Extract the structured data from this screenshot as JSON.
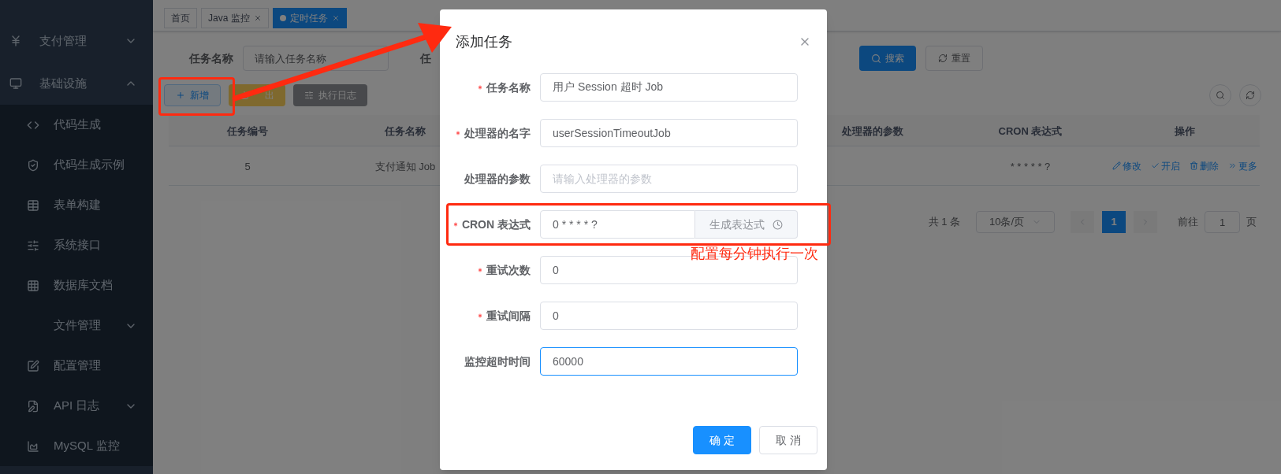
{
  "sidebar": {
    "items": [
      {
        "label": "支付管理",
        "expanded": false
      },
      {
        "label": "基础设施",
        "expanded": true,
        "children": [
          {
            "label": "代码生成"
          },
          {
            "label": "代码生成示例"
          },
          {
            "label": "表单构建"
          },
          {
            "label": "系统接口"
          },
          {
            "label": "数据库文档"
          },
          {
            "label": "文件管理",
            "expanded": false
          },
          {
            "label": "配置管理"
          },
          {
            "label": "API 日志",
            "expanded": false
          },
          {
            "label": "MySQL 监控"
          }
        ]
      }
    ]
  },
  "tabs": [
    {
      "label": "首页",
      "selected": false,
      "closable": false
    },
    {
      "label": "Java 监控",
      "selected": false,
      "closable": true
    },
    {
      "label": "定时任务",
      "selected": true,
      "closable": true
    }
  ],
  "search": {
    "fields": [
      {
        "label": "任务名称",
        "placeholder": "请输入任务名称"
      },
      {
        "label": "任"
      }
    ],
    "buttons": [
      "搜索",
      "重置"
    ]
  },
  "toolbar": {
    "buttons": [
      {
        "kind": "add",
        "label": "新增"
      },
      {
        "kind": "export",
        "label": "出"
      },
      {
        "kind": "log",
        "label": "执行日志"
      }
    ]
  },
  "table": {
    "columns": [
      "任务编号",
      "任务名称",
      "处理器的参数",
      "CRON 表达式",
      "操作"
    ],
    "rows": [
      {
        "cells": [
          "5",
          "支付通知 Job",
          "",
          "* * * * * ?"
        ],
        "actions": [
          "修改",
          "开启",
          "删除",
          "更多"
        ]
      }
    ]
  },
  "pagination": {
    "total": "共 1 条",
    "page_size": "10条/页",
    "pages": [
      {
        "label": "1",
        "selected": true
      }
    ],
    "goto_label": "前往",
    "goto_value": "1",
    "goto_suffix": "页"
  },
  "dialog": {
    "title": "添加任务",
    "fields": [
      {
        "label": "任务名称",
        "required": true,
        "value": "用户 Session 超时 Job",
        "focused": false
      },
      {
        "label": "处理器的名字",
        "required": true,
        "value": "userSessionTimeoutJob",
        "focused": false
      },
      {
        "label": "处理器的参数",
        "required": false,
        "placeholder": "请输入处理器的参数",
        "focused": false
      },
      {
        "label": "CRON 表达式",
        "required": true,
        "value": "0 * * * * ?",
        "focused": false,
        "addon": "生成表达式"
      },
      {
        "label": "重试次数",
        "required": true,
        "value": "0",
        "focused": false
      },
      {
        "label": "重试间隔",
        "required": true,
        "value": "0",
        "focused": false
      },
      {
        "label": "监控超时时间",
        "required": false,
        "value": "60000",
        "focused": true
      }
    ],
    "buttons": [
      {
        "kind": "primary",
        "label": "确 定"
      },
      {
        "kind": "default",
        "label": "取 消"
      }
    ]
  },
  "annotation": {
    "text": "配置每分钟执行一次"
  }
}
